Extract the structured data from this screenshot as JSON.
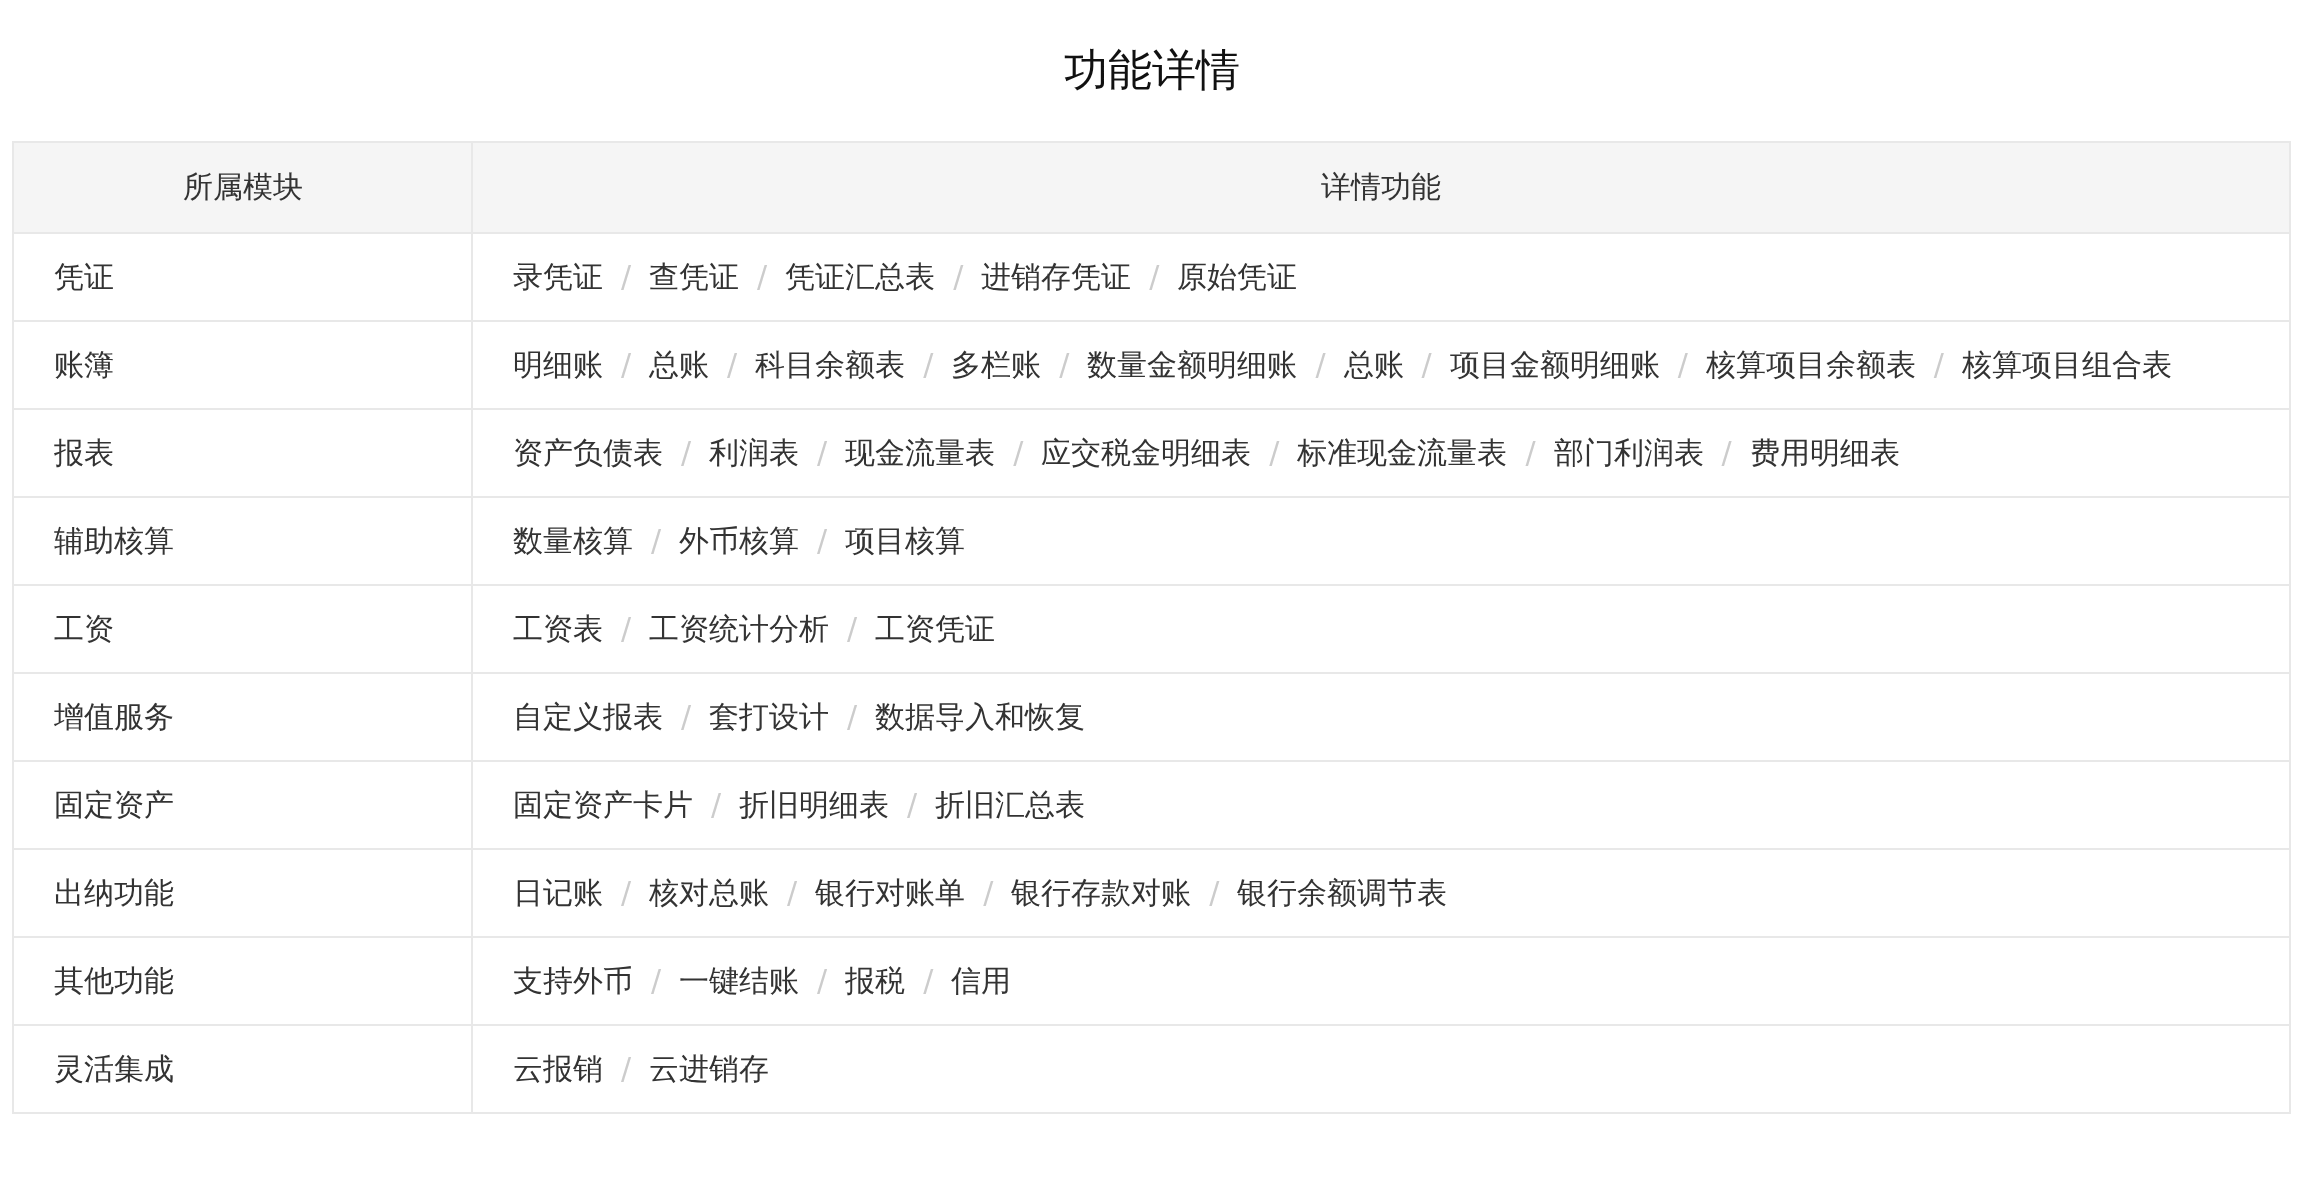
{
  "title": "功能详情",
  "table": {
    "columns": [
      "所属模块",
      "详情功能"
    ],
    "separator": "/",
    "rows": [
      {
        "module": "凭证",
        "features": [
          "录凭证",
          "查凭证",
          "凭证汇总表",
          "进销存凭证",
          "原始凭证"
        ]
      },
      {
        "module": "账簿",
        "features": [
          "明细账",
          "总账",
          "科目余额表",
          "多栏账",
          "数量金额明细账",
          "总账",
          "项目金额明细账",
          "核算项目余额表",
          "核算项目组合表"
        ]
      },
      {
        "module": "报表",
        "features": [
          "资产负债表",
          "利润表",
          "现金流量表",
          "应交税金明细表",
          "标准现金流量表",
          "部门利润表",
          "费用明细表"
        ]
      },
      {
        "module": "辅助核算",
        "features": [
          "数量核算",
          "外币核算",
          "项目核算"
        ]
      },
      {
        "module": "工资",
        "features": [
          "工资表",
          "工资统计分析",
          "工资凭证"
        ]
      },
      {
        "module": "增值服务",
        "features": [
          "自定义报表",
          "套打设计",
          "数据导入和恢复"
        ]
      },
      {
        "module": "固定资产",
        "features": [
          "固定资产卡片",
          "折旧明细表",
          "折旧汇总表"
        ]
      },
      {
        "module": "出纳功能",
        "features": [
          "日记账",
          "核对总账",
          "银行对账单",
          "银行存款对账",
          "银行余额调节表"
        ]
      },
      {
        "module": "其他功能",
        "features": [
          "支持外币",
          "一键结账",
          "报税",
          "信用"
        ]
      },
      {
        "module": "灵活集成",
        "features": [
          "云报销",
          "云进销存"
        ]
      }
    ]
  }
}
